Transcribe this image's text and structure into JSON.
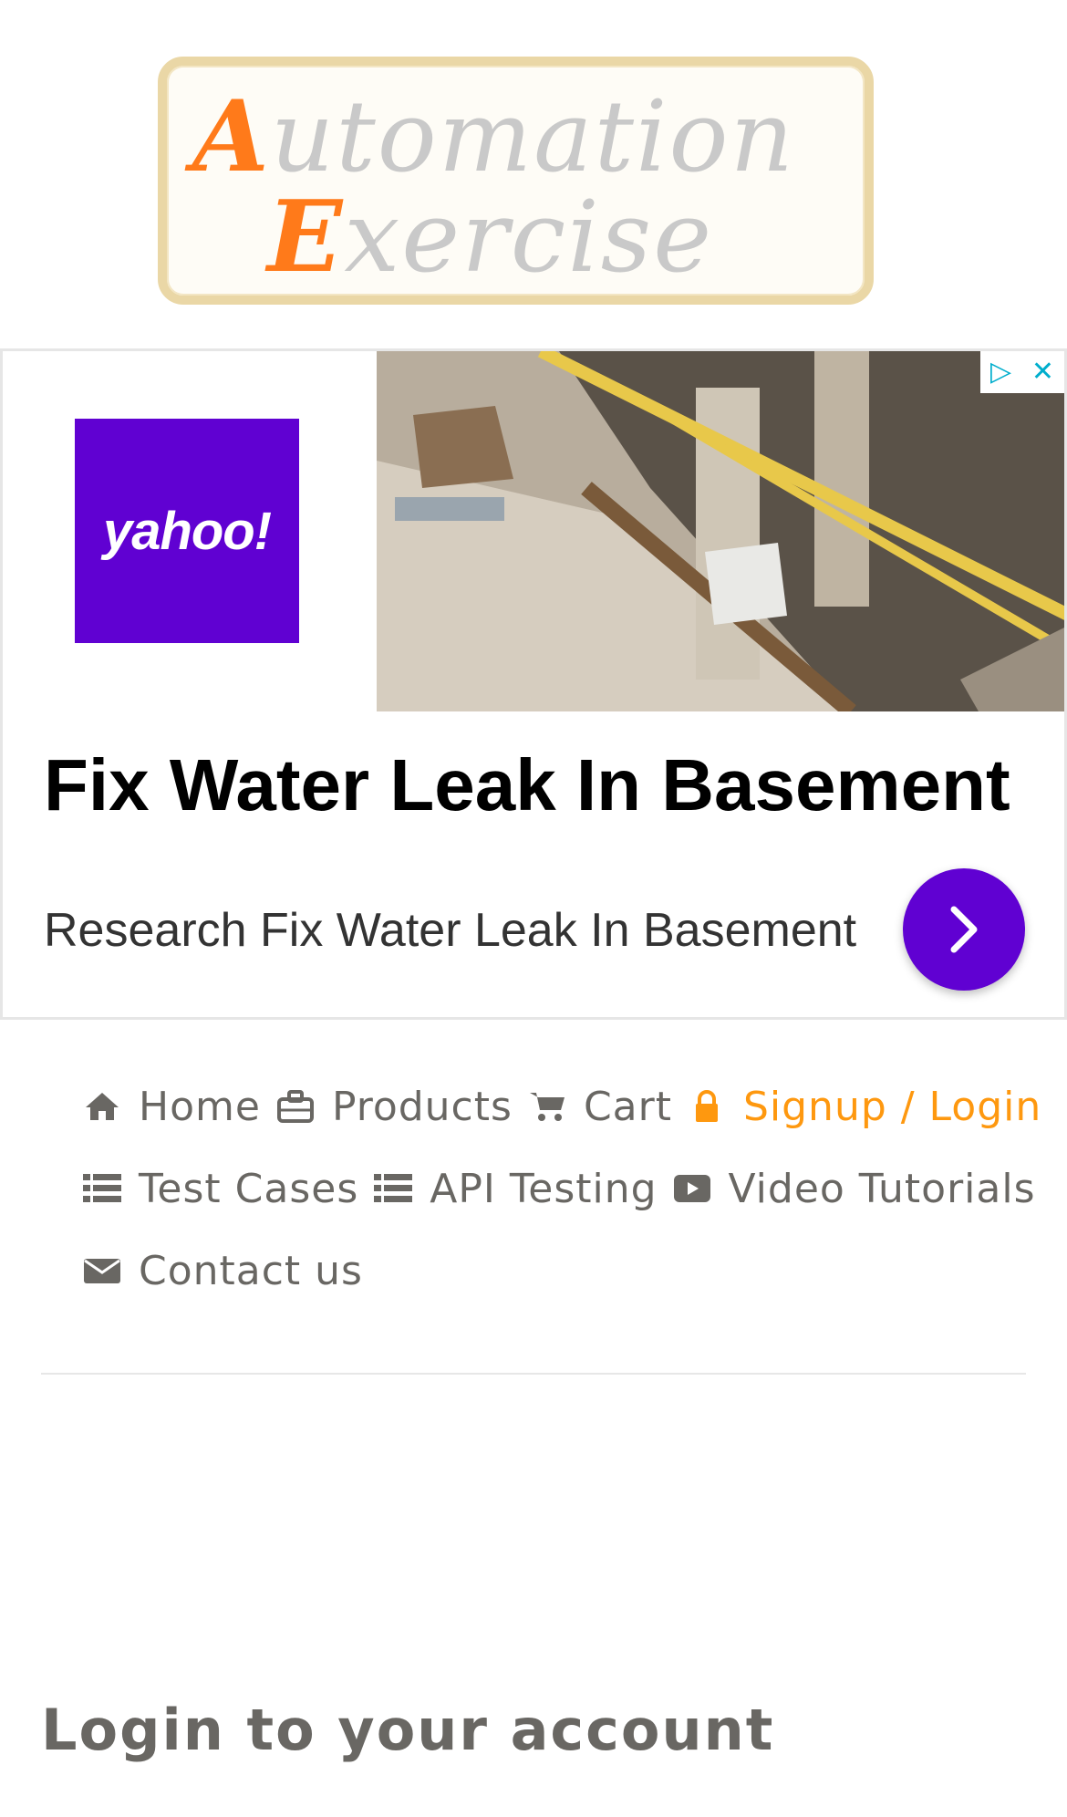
{
  "logo": {
    "line1_cap": "A",
    "line1_rest": "utomation",
    "line2_cap": "E",
    "line2_rest": "xercise"
  },
  "ad": {
    "brand": "yahoo!",
    "title": "Fix Water Leak In Basement",
    "subtitle": "Research Fix Water Leak In Basement",
    "accent": "#6001d2"
  },
  "nav": {
    "items": [
      {
        "label": "Home",
        "icon": "home-icon"
      },
      {
        "label": "Products",
        "icon": "products-icon"
      },
      {
        "label": "Cart",
        "icon": "cart-icon"
      },
      {
        "label": "Signup / Login",
        "icon": "lock-icon",
        "active": true
      },
      {
        "label": "Test Cases",
        "icon": "list-icon"
      },
      {
        "label": "API Testing",
        "icon": "list-icon"
      },
      {
        "label": "Video Tutorials",
        "icon": "youtube-play-icon"
      },
      {
        "label": "Contact us",
        "icon": "envelope-icon"
      }
    ],
    "active_color": "#fe980f"
  },
  "login": {
    "title": "Login to your account"
  }
}
